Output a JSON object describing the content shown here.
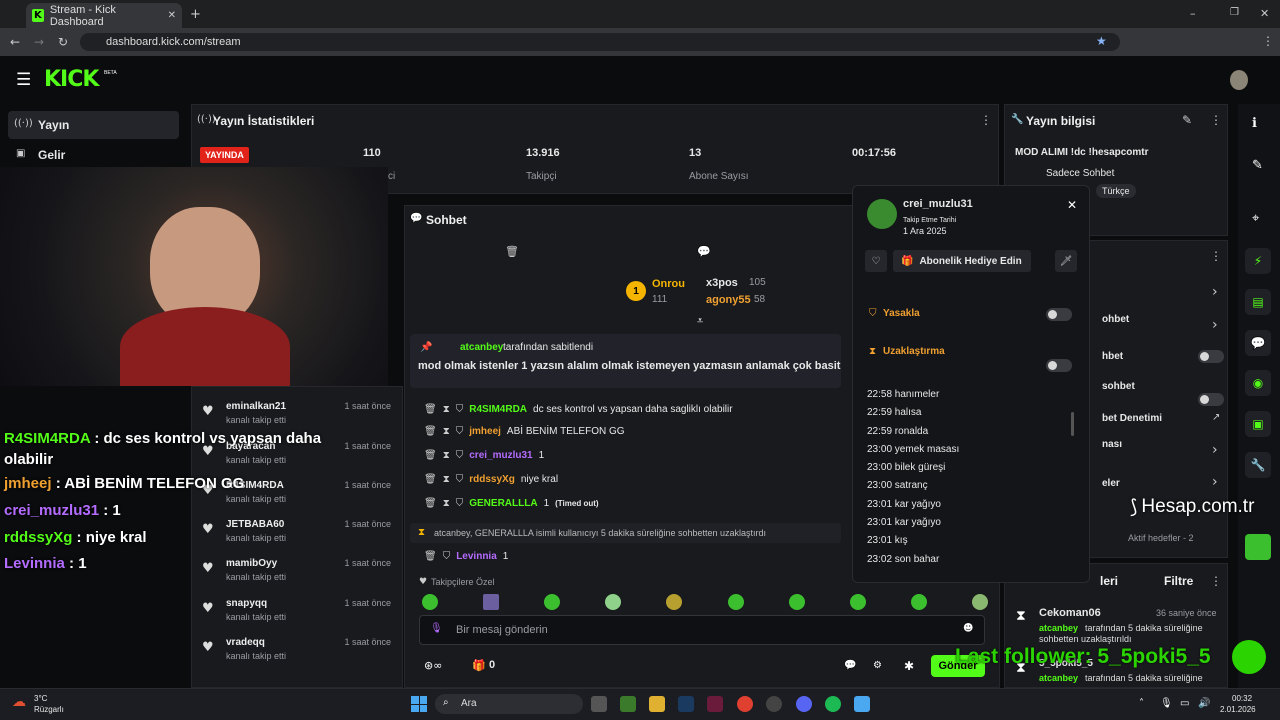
{
  "browser": {
    "tab_title": "Stream - Kick Dashboard",
    "url": "dashboard.kick.com/stream"
  },
  "header": {
    "logo": "KICK",
    "beta": "BETA"
  },
  "sidebar": {
    "items": [
      {
        "label": "Yayın"
      },
      {
        "label": "Gelir"
      }
    ]
  },
  "stats": {
    "title": "Yayın İstatistikleri",
    "live_badge": "YAYINDA",
    "viewers": "110",
    "viewers_label": "ci",
    "followers": "13.916",
    "followers_label": "Takipçi",
    "subs": "13",
    "subs_label": "Abone Sayısı",
    "time": "00:17:56"
  },
  "chat": {
    "title": "Sohbet",
    "gifters": [
      {
        "rank": "1",
        "name": "Onrou",
        "count": "111"
      },
      {
        "name": "x3pos",
        "count": "105"
      },
      {
        "name": "agony55",
        "count": "58"
      }
    ],
    "pinned_by": "atcanbey",
    "pinned_suffix": "tarafından sabitlendi",
    "pinned_text": "mod olmak istenler 1 yazsın alalım olmak istemeyen yazmasın anlamak çok basit",
    "messages": [
      {
        "user": "R4SIM4RDA",
        "text": "dc ses kontrol vs yapsan daha sagliklı olabilir",
        "color": "#53fc18"
      },
      {
        "user": "jmheej",
        "text": "ABİ BENİM TELEFON GG",
        "color": "#f0a030"
      },
      {
        "user": "crei_muzlu31",
        "text": "1",
        "color": "#b46cff"
      },
      {
        "user": "rddssyXg",
        "text": "niye kral",
        "color": "#f0a030"
      },
      {
        "user": "GENERALLLA",
        "text": "1",
        "suffix": "(Timed out)",
        "color": "#53fc18"
      }
    ],
    "timeout_notice": "atcanbey, GENERALLLA isimli kullanıcıyı 5 dakika süreliğine sohbetten uzaklaştırdı",
    "last_msg": {
      "user": "Levinnia",
      "text": "1",
      "color": "#b46cff"
    },
    "followers_only": "Takipçilere Özel",
    "input_placeholder": "Bir mesaj gönderin",
    "points": "0",
    "send": "Gönder"
  },
  "followers": [
    {
      "name": "eminalkan21",
      "sub": "kanalı takip etti",
      "time": "1 saat önce"
    },
    {
      "name": "bayaracan",
      "sub": "kanalı takip etti",
      "time": "1 saat önce"
    },
    {
      "name": "R4SIM4RDA",
      "sub": "kanalı takip etti",
      "time": "1 saat önce"
    },
    {
      "name": "JETBABA60",
      "sub": "kanalı takip etti",
      "time": "1 saat önce"
    },
    {
      "name": "mamibOyy",
      "sub": "kanalı takip etti",
      "time": "1 saat önce"
    },
    {
      "name": "snapyqq",
      "sub": "kanalı takip etti",
      "time": "1 saat önce"
    },
    {
      "name": "vradeqq",
      "sub": "kanalı takip etti",
      "time": "1 saat önce"
    }
  ],
  "popup": {
    "username": "crei_muzlu31",
    "follow_label": "Takip Etme Tarihi",
    "follow_date": "1 Ara 2025",
    "gift_button": "Abonelik Hediye Edin",
    "ban": "Yasakla",
    "timeout": "Uzaklaştırma",
    "history": [
      "22:58 hanımeler",
      "22:59 halısa",
      "22:59 ronalda",
      "23:00 yemek masası",
      "23:00 bilek güreşi",
      "23:00 satranç",
      "23:01 kar yağıyo",
      "23:01 kar yağıyo",
      "23:01 kış",
      "23:02 son bahar"
    ]
  },
  "info": {
    "title": "Yayın bilgisi",
    "stream_title": "MOD ALIMI !dc !hesapcomtr",
    "category": "Sadece Sohbet",
    "language": "Türkçe"
  },
  "settings": {
    "rows": [
      "ohbet",
      "hbet",
      "sohbet",
      "bet Denetimi",
      "nası",
      "eler"
    ],
    "goal": "Aktif hedefler - 2"
  },
  "activity": {
    "title": "leri",
    "filter": "Filtre",
    "items": [
      {
        "name": "Cekoman06",
        "time": "36 saniye önce",
        "by": "atcanbey",
        "text": "tarafından 5 dakika süreliğine sohbetten uzaklaştırıldı"
      },
      {
        "name": "5_5poki5_5",
        "time": "",
        "by": "atcanbey",
        "text": "tarafından 5 dakika süreliğine"
      }
    ]
  },
  "overlay": {
    "chat": [
      {
        "user": "R4SIM4RDA",
        "text": ": dc ses kontrol vs yapsan daha",
        "cont": "olabilir",
        "color": "#53fc18"
      },
      {
        "user": "jmheej",
        "text": ": ABİ BENİM TELEFON GG",
        "color": "#f0a030"
      },
      {
        "user": "crei_muzlu31",
        "text": ": 1",
        "color": "#b46cff"
      },
      {
        "user": "rddssyXg",
        "text": ": niye kral",
        "color": "#53fc18"
      },
      {
        "user": "Levinnia",
        "text": ": 1",
        "color": "#b46cff"
      }
    ],
    "watermark": "Hesap.com.tr",
    "last_follower": "Last follower: 5_5poki5_5"
  },
  "taskbar": {
    "temp": "3°C",
    "weather": "Rüzgarlı",
    "search": "Ara",
    "time": "00:32",
    "date": "2.01.2026"
  },
  "colors": {
    "accent": "#53fc18",
    "live": "#e2231a",
    "panel": "#191a1e"
  }
}
